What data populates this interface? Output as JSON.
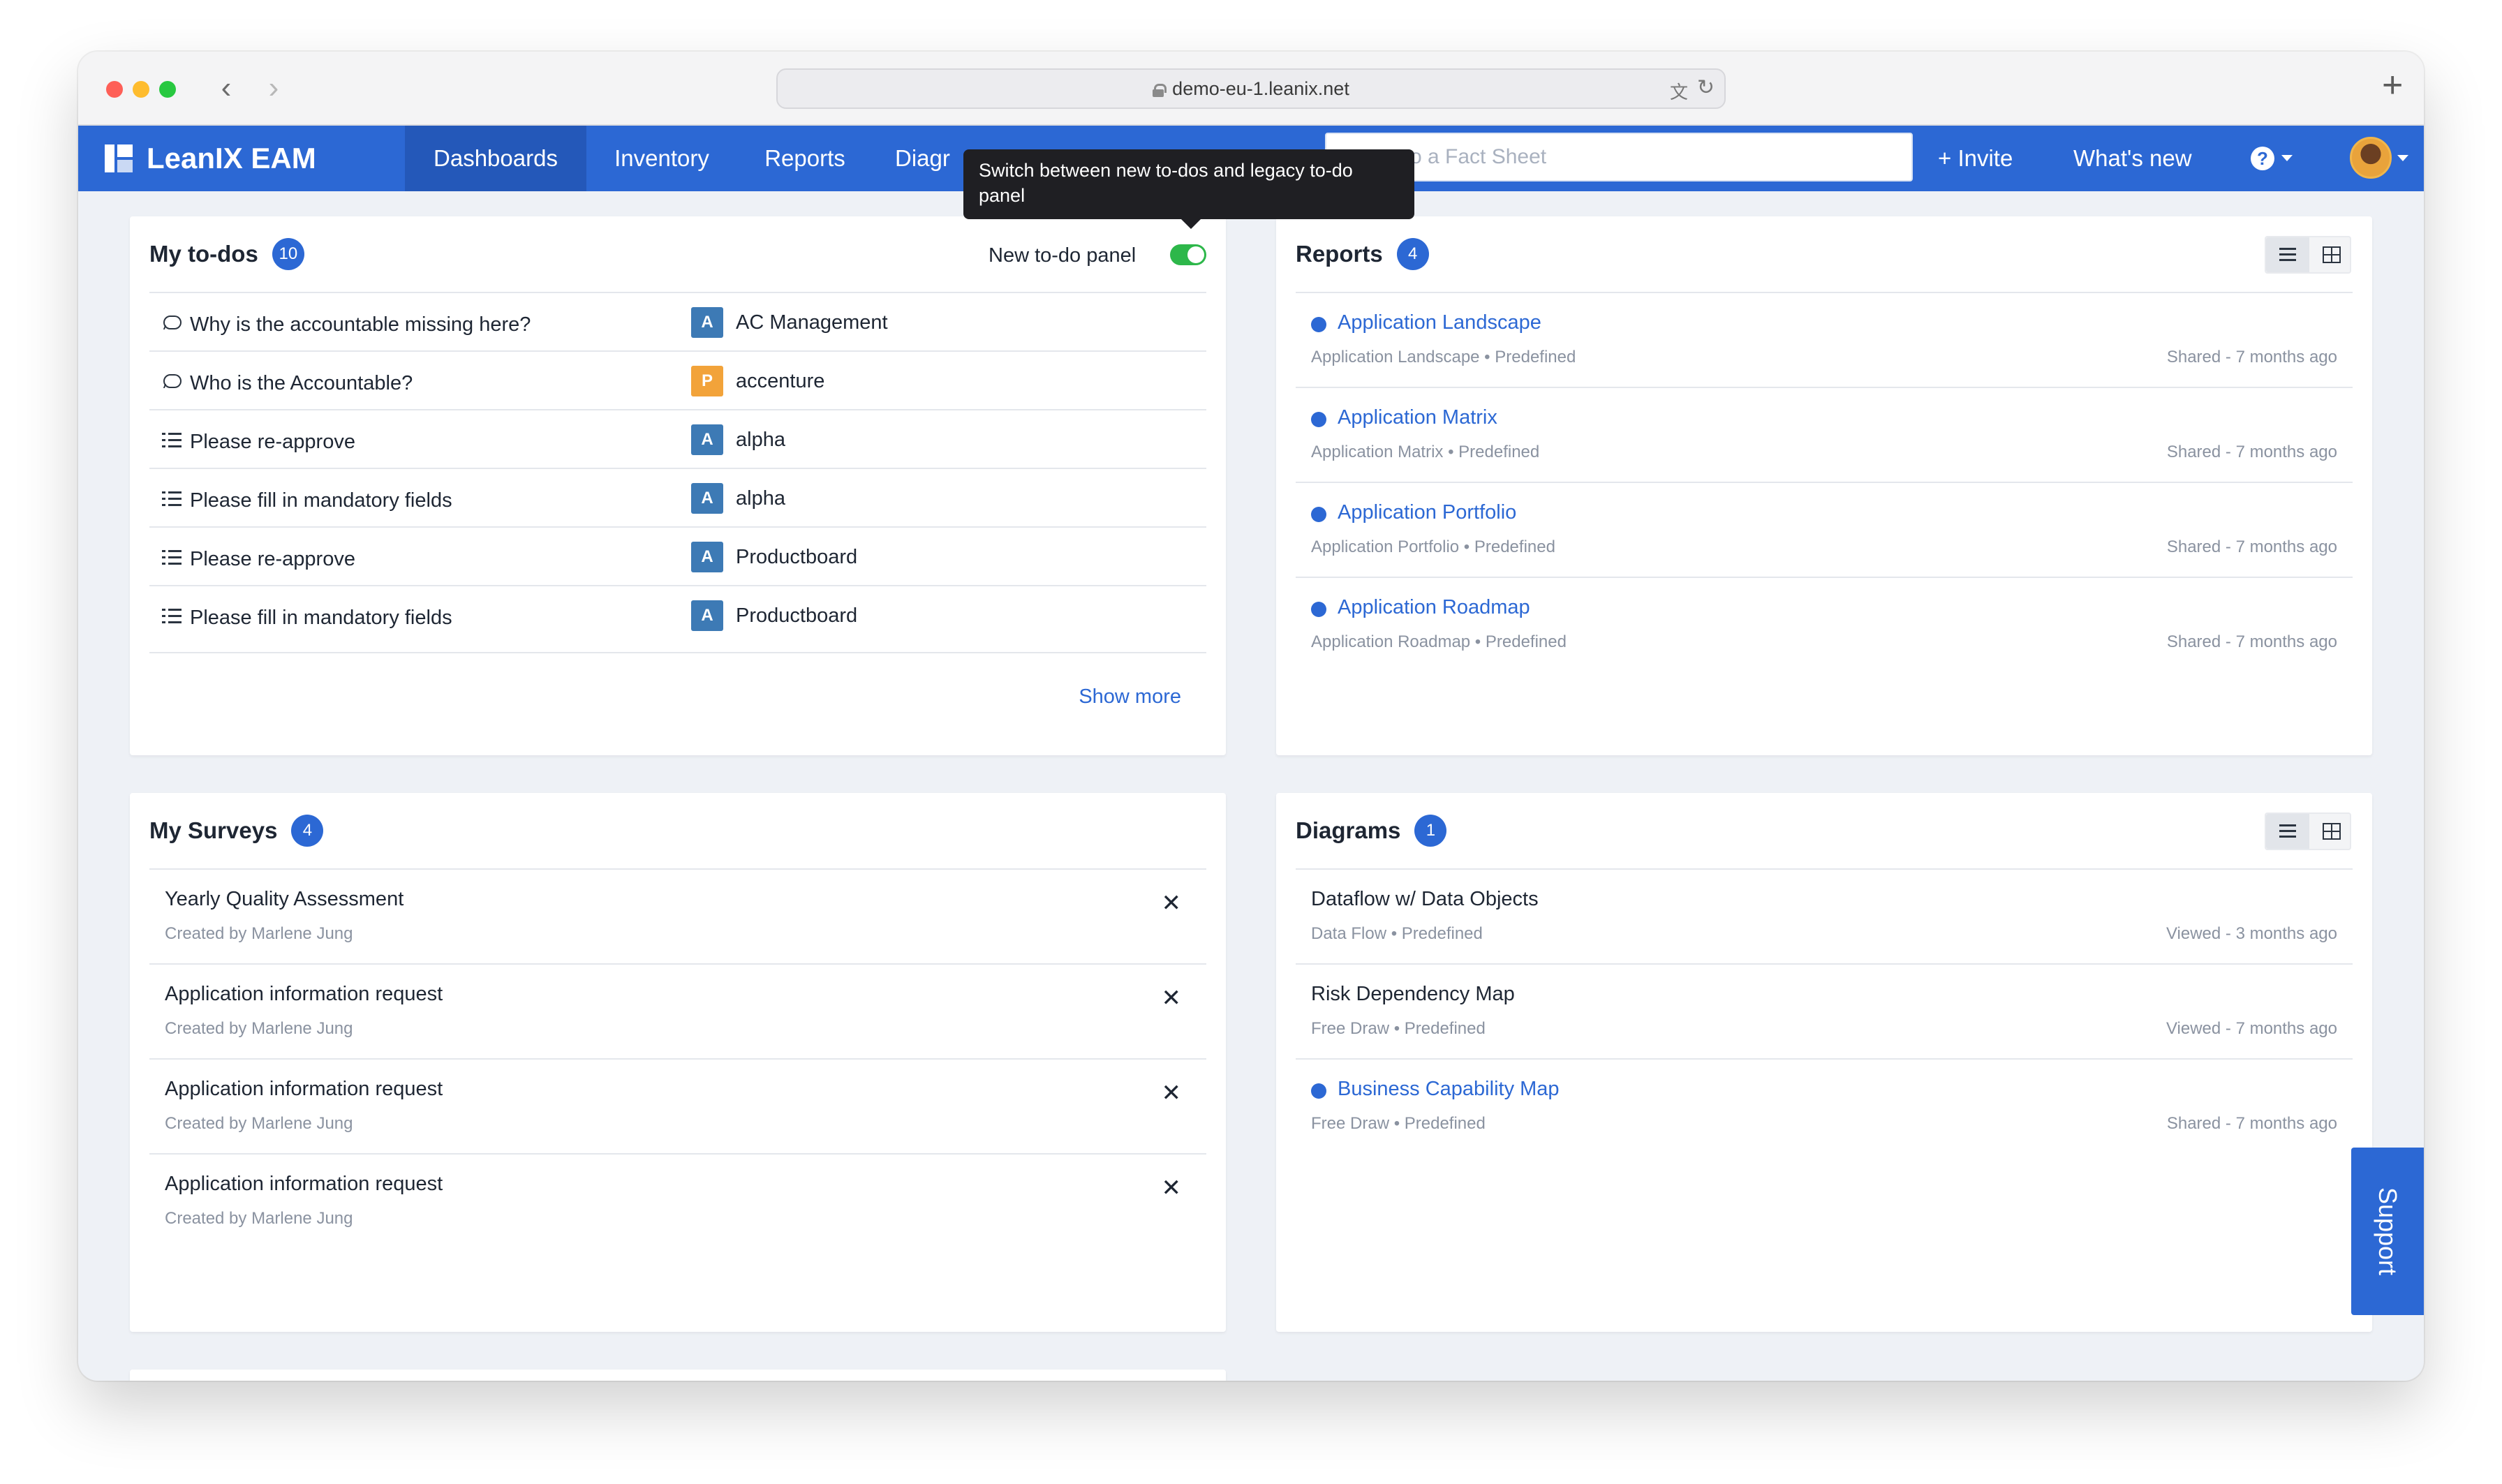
{
  "browser": {
    "url": "demo-eu-1.leanix.net",
    "back_glyph": "‹",
    "forward_glyph": "›",
    "new_tab_glyph": "+",
    "icons": [
      "lock-icon",
      "translate-icon",
      "reload-icon"
    ]
  },
  "header": {
    "brand": "LeanIX EAM",
    "tabs": [
      {
        "label": "Dashboards",
        "active": true
      },
      {
        "label": "Inventory",
        "active": false
      },
      {
        "label": "Reports",
        "active": false
      },
      {
        "label": "Diagr",
        "active": false
      }
    ],
    "search_placeholder": "o a Fact Sheet",
    "invite_label": "+ Invite",
    "whats_new_label": "What's new",
    "help_glyph": "?",
    "colors": {
      "primary": "#2c68d4",
      "active_tab": "#2458b9"
    }
  },
  "tooltip": {
    "text": "Switch between new to-dos and legacy to-do panel"
  },
  "todos": {
    "title": "My to-dos",
    "count": "10",
    "toggle_label": "New to-do panel",
    "toggle_on": true,
    "items": [
      {
        "icon": "chat-icon",
        "text": "Why is the accountable missing here?",
        "badge": "A",
        "badge_color": "#3d7ab5",
        "fact_sheet": "AC Management"
      },
      {
        "icon": "chat-icon",
        "text": "Who is the Accountable?",
        "badge": "P",
        "badge_color": "#f2a33a",
        "fact_sheet": "accenture"
      },
      {
        "icon": "checklist-icon",
        "text": "Please re-approve",
        "badge": "A",
        "badge_color": "#3d7ab5",
        "fact_sheet": "alpha"
      },
      {
        "icon": "checklist-icon",
        "text": "Please fill in mandatory fields",
        "badge": "A",
        "badge_color": "#3d7ab5",
        "fact_sheet": "alpha"
      },
      {
        "icon": "checklist-icon",
        "text": "Please re-approve",
        "badge": "A",
        "badge_color": "#3d7ab5",
        "fact_sheet": "Productboard"
      },
      {
        "icon": "checklist-icon",
        "text": "Please fill in mandatory fields",
        "badge": "A",
        "badge_color": "#3d7ab5",
        "fact_sheet": "Productboard"
      }
    ],
    "show_more": "Show more"
  },
  "reports": {
    "title": "Reports",
    "count": "4",
    "items": [
      {
        "title": "Application Landscape",
        "sub": "Application Landscape • Predefined",
        "meta": "Shared - 7 months ago"
      },
      {
        "title": "Application Matrix",
        "sub": "Application Matrix • Predefined",
        "meta": "Shared - 7 months ago"
      },
      {
        "title": "Application Portfolio",
        "sub": "Application Portfolio • Predefined",
        "meta": "Shared - 7 months ago"
      },
      {
        "title": "Application Roadmap",
        "sub": "Application Roadmap • Predefined",
        "meta": "Shared - 7 months ago"
      }
    ]
  },
  "surveys": {
    "title": "My Surveys",
    "count": "4",
    "close_glyph": "✕",
    "items": [
      {
        "title": "Yearly Quality Assessment",
        "sub": "Created by Marlene Jung"
      },
      {
        "title": "Application information request",
        "sub": "Created by Marlene Jung"
      },
      {
        "title": "Application information request",
        "sub": "Created by Marlene Jung"
      },
      {
        "title": "Application information request",
        "sub": "Created by Marlene Jung"
      }
    ]
  },
  "diagrams": {
    "title": "Diagrams",
    "count": "1",
    "items": [
      {
        "title": "Dataflow w/ Data Objects",
        "sub": "Data Flow • Predefined",
        "meta": "Viewed - 3 months ago",
        "shared": false
      },
      {
        "title": "Risk Dependency Map",
        "sub": "Free Draw • Predefined",
        "meta": "Viewed - 7 months ago",
        "shared": false
      },
      {
        "title": "Business Capability Map",
        "sub": "Free Draw • Predefined",
        "meta": "Shared - 7 months ago",
        "shared": true
      }
    ]
  },
  "support_label": "Support"
}
